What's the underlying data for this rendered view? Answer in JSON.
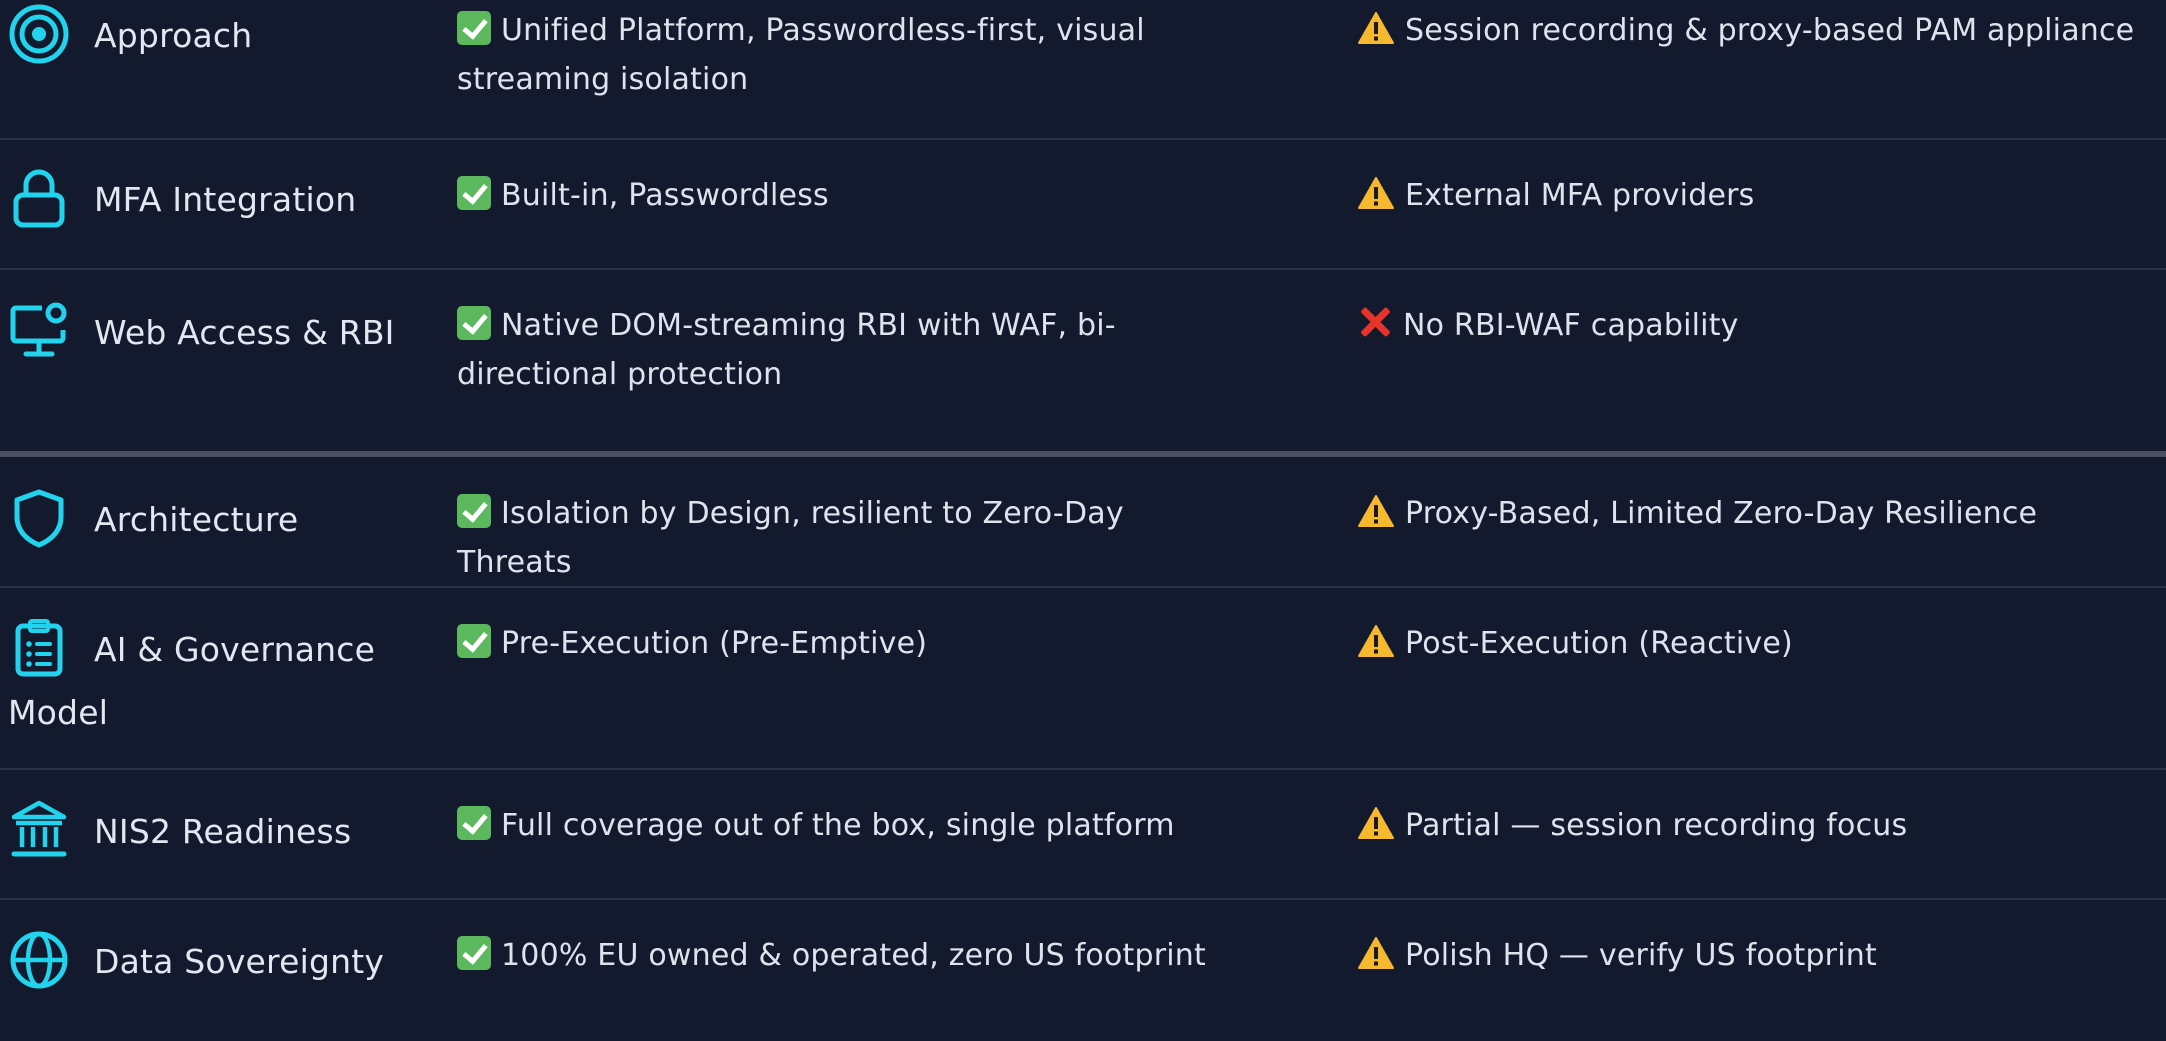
{
  "rows": [
    {
      "label": "Approach",
      "icon": "target-icon",
      "col_a": {
        "status": "check",
        "text": "Unified Platform, Passwordless-first, visual streaming isolation"
      },
      "col_b": {
        "status": "warning",
        "text": "Session recording & proxy-based PAM appliance"
      }
    },
    {
      "label": "MFA Integration",
      "icon": "lock-icon",
      "col_a": {
        "status": "check",
        "text": "Built-in, Passwordless"
      },
      "col_b": {
        "status": "warning",
        "text": "External MFA providers"
      }
    },
    {
      "label": "Web Access & RBI",
      "icon": "monitor-user-icon",
      "col_a": {
        "status": "check",
        "text": "Native DOM-streaming RBI with WAF, bi-directional protection"
      },
      "col_b": {
        "status": "cross",
        "text": "No RBI-WAF capability"
      }
    },
    {
      "label": "Architecture",
      "icon": "shield-icon",
      "col_a": {
        "status": "check",
        "text": "Isolation by Design, resilient to Zero-Day Threats"
      },
      "col_b": {
        "status": "warning",
        "text": "Proxy-Based, Limited Zero-Day Resilience"
      }
    },
    {
      "label": "AI & Governance Model",
      "icon": "clipboard-list-icon",
      "col_a": {
        "status": "check",
        "text": "Pre-Execution (Pre-Emptive)"
      },
      "col_b": {
        "status": "warning",
        "text": "Post-Execution (Reactive)"
      }
    },
    {
      "label": "NIS2 Readiness",
      "icon": "bank-icon",
      "col_a": {
        "status": "check",
        "text": "Full coverage out of the box, single platform"
      },
      "col_b": {
        "status": "warning",
        "text": "Partial — session recording focus"
      }
    },
    {
      "label": "Data Sovereignty",
      "icon": "globe-icon",
      "col_a": {
        "status": "check",
        "text": "100% EU owned & operated, zero US footprint"
      },
      "col_b": {
        "status": "warning",
        "text": "Polish HQ — verify US footprint"
      }
    }
  ],
  "colors": {
    "background": "#141a2e",
    "icon": "#22d3ee",
    "check": "#5cb85c",
    "warning": "#f5b82e",
    "cross": "#e8332b",
    "divider": "#2a3148"
  }
}
